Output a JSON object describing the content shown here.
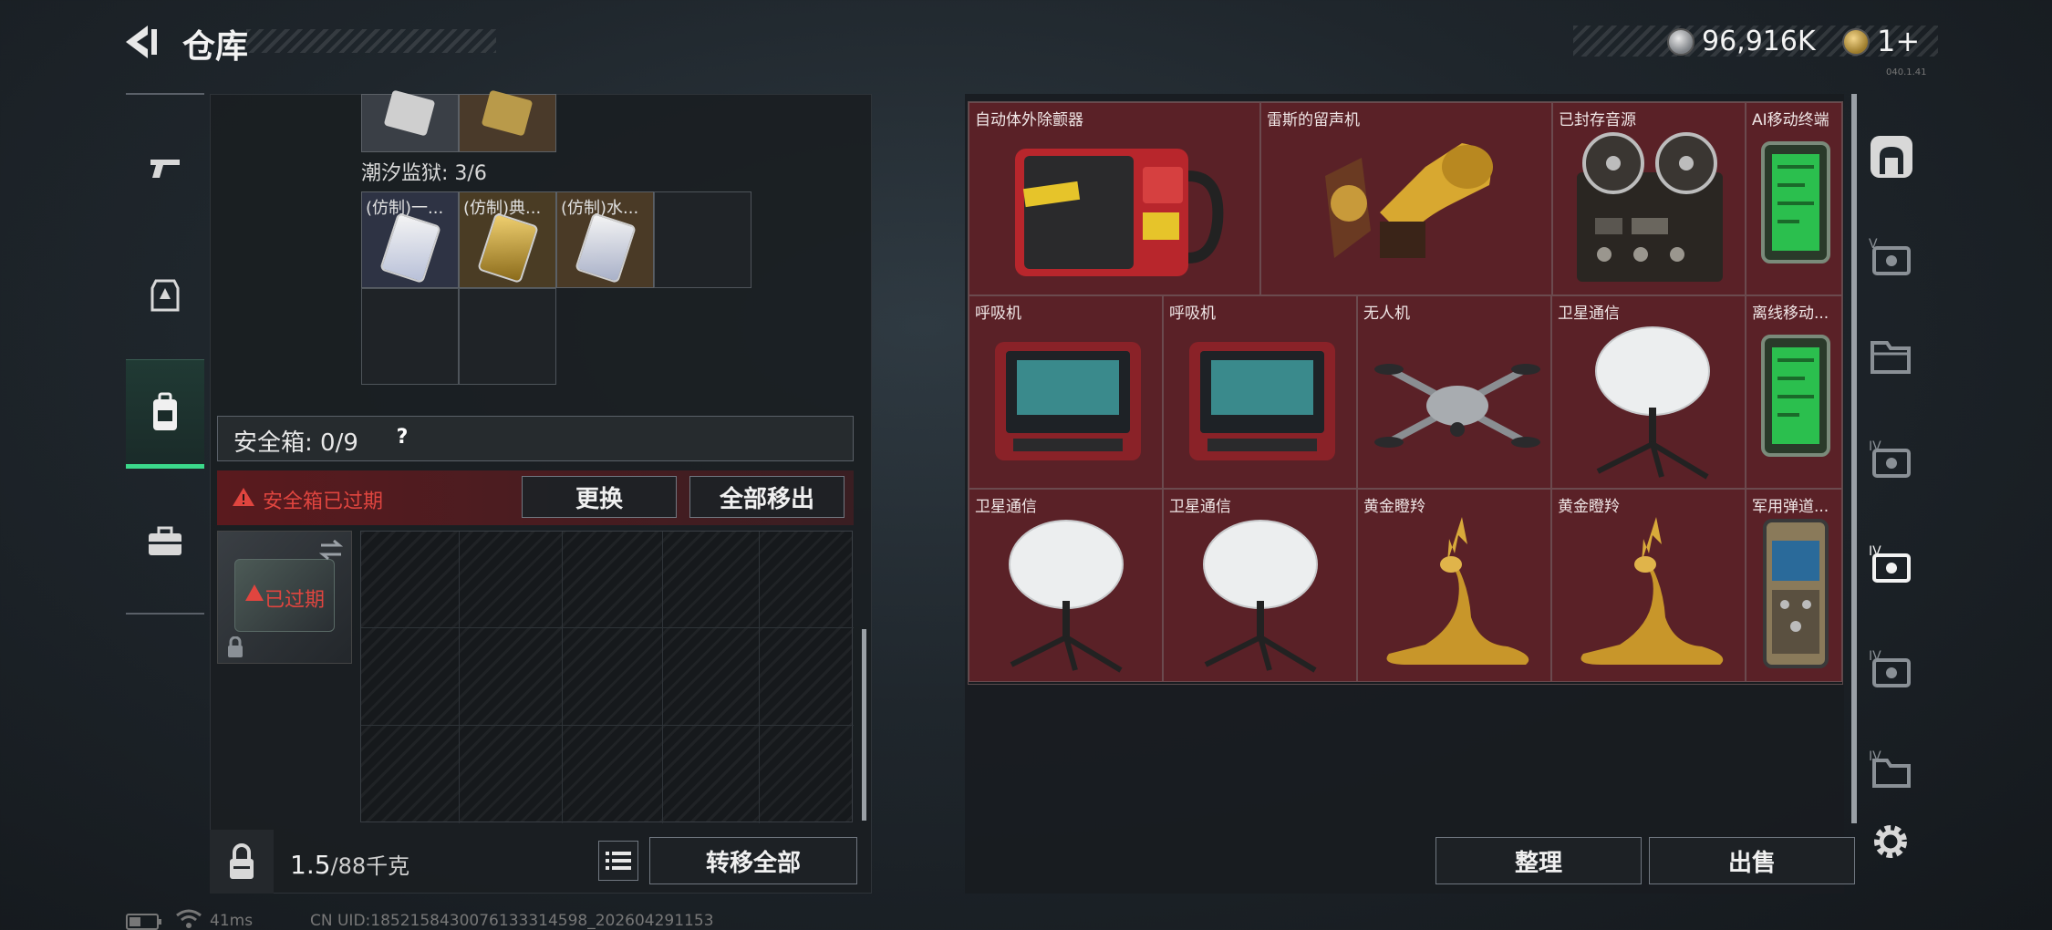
{
  "header": {
    "title": "仓库",
    "currency_value": "96,916K",
    "ticket_value": "1+",
    "version": "040.1.41"
  },
  "left_nav": {
    "items": [
      "weapon-icon",
      "armor-icon",
      "backpack-icon",
      "toolbox-icon"
    ],
    "active_index": 2
  },
  "left_panel": {
    "prison_label": "潮汐监狱: 3/6",
    "cards": [
      "(仿制)一...",
      "(仿制)典...",
      "(仿制)水..."
    ],
    "safebox_title": "安全箱: 0/9",
    "safebox_help": "?",
    "expired_text": "安全箱已过期",
    "replace_label": "更换",
    "remove_all_label": "全部移出",
    "safebox_thumb_text": "已过期",
    "weight_value": "1.5",
    "weight_unit": "/88千克",
    "transfer_all_label": "转移全部"
  },
  "inventory": {
    "items": [
      {
        "label": "自动体外除颤器",
        "icon": "aed-icon"
      },
      {
        "label": "雷斯的留声机",
        "icon": "gramophone-icon"
      },
      {
        "label": "已封存音源",
        "icon": "tape-recorder-icon"
      },
      {
        "label": "AI移动终端",
        "icon": "tablet-icon"
      },
      {
        "label": "呼吸机",
        "icon": "ventilator-icon"
      },
      {
        "label": "呼吸机",
        "icon": "ventilator-icon"
      },
      {
        "label": "无人机",
        "icon": "drone-icon"
      },
      {
        "label": "卫星通信",
        "icon": "satellite-dish-icon"
      },
      {
        "label": "离线移动...",
        "icon": "tablet-icon"
      },
      {
        "label": "卫星通信",
        "icon": "satellite-dish-icon"
      },
      {
        "label": "卫星通信",
        "icon": "satellite-dish-icon"
      },
      {
        "label": "黄金瞪羚",
        "icon": "golden-gazelle-icon"
      },
      {
        "label": "黄金瞪羚",
        "icon": "golden-gazelle-icon"
      },
      {
        "label": "军用弹道...",
        "icon": "ballistic-computer-icon"
      }
    ],
    "sort_label": "整理",
    "sell_label": "出售"
  },
  "right_nav": {
    "items": [
      "storage-room-icon",
      "tab-v-icon",
      "folder-icon",
      "tab-iv-icon",
      "tab-iv-active-icon",
      "tab-iv-2-icon",
      "tab-iv-3-icon"
    ],
    "tab_labels": [
      "V",
      "IV",
      "IV",
      "IV",
      "IV"
    ]
  },
  "status": {
    "ping": "41ms",
    "uid": "CN UID:1852158430076133314598_202604291153"
  },
  "colors": {
    "accent_green": "#3bd98b",
    "item_red": "#5a2127",
    "warning_red": "#e0453f"
  }
}
